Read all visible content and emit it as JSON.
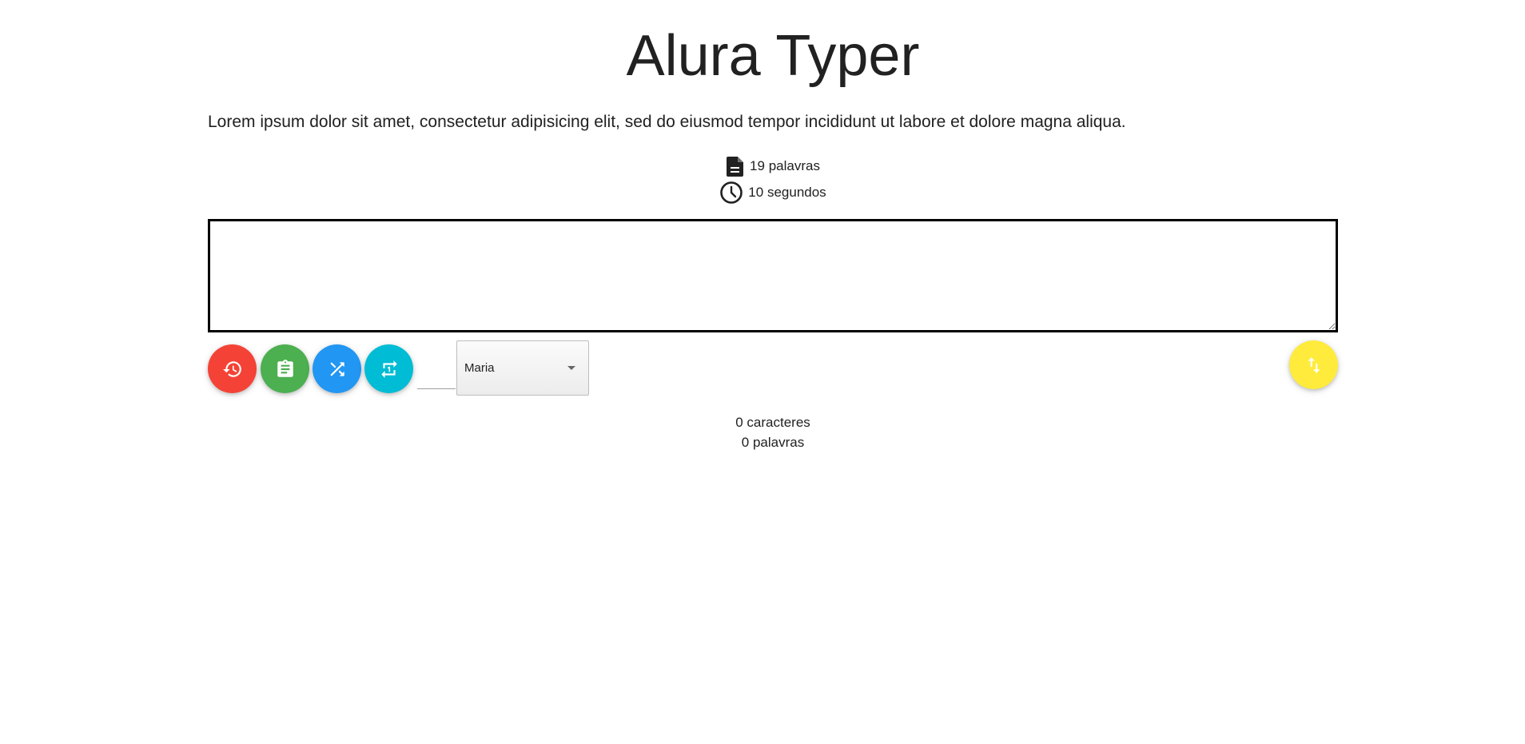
{
  "header": {
    "title": "Alura Typer"
  },
  "phrase": {
    "text": "Lorem ipsum dolor sit amet, consectetur adipisicing elit, sed do eiusmod tempor incididunt ut labore et dolore magna aliqua."
  },
  "info": {
    "word_count": "19",
    "word_label": "palavras",
    "time_count": "10",
    "time_label": "segundos",
    "words_icon": "description-icon",
    "time_icon": "clock-icon"
  },
  "typing_area": {
    "value": "",
    "placeholder": ""
  },
  "actions": [
    {
      "icon": "history-icon",
      "color": "#F44336"
    },
    {
      "icon": "assignment-icon",
      "color": "#4CAF50"
    },
    {
      "icon": "shuffle-icon",
      "color": "#2196F3"
    },
    {
      "icon": "repeat-one-icon",
      "color": "#00BCD4"
    },
    {
      "icon": "swap-vert-icon",
      "color": "#FFEB3B"
    }
  ],
  "player_select": {
    "selected": "Maria"
  },
  "counters": {
    "chars_value": "0",
    "chars_label": "caracteres",
    "words_value": "0",
    "words_label": "palavras"
  }
}
